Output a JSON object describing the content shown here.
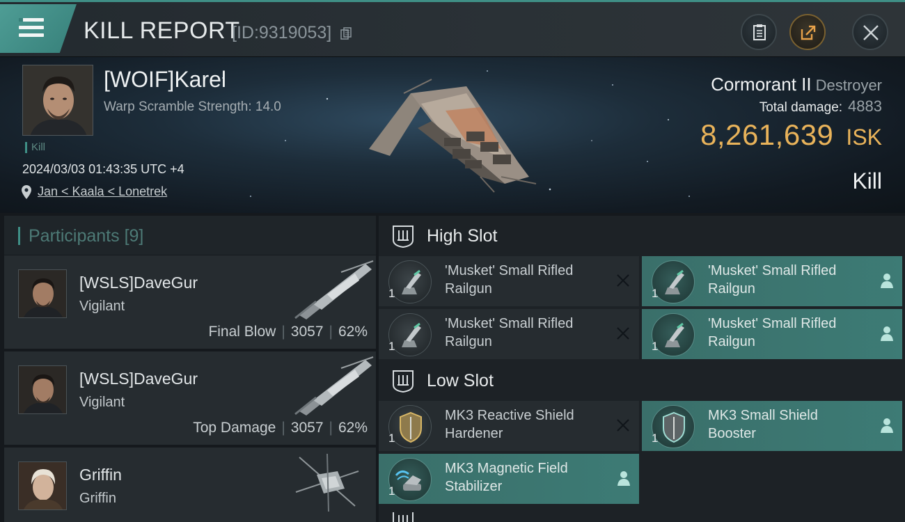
{
  "header": {
    "title": "KILL REPORT",
    "report_id": "[ID:9319053]"
  },
  "victim": {
    "name": "[WOIF]Karel",
    "warp_scramble": "Warp Scramble Strength: 14.0",
    "tag": "Kill",
    "datetime": "2024/03/03 01:43:35 UTC +4",
    "location": "Jan < Kaala < Lonetrek",
    "ship_name": "Cormorant II",
    "ship_class": "Destroyer",
    "total_damage_label": "Total damage:",
    "total_damage": "4883",
    "isk_value": "8,261,639",
    "isk_unit": "ISK",
    "result": "Kill"
  },
  "participants": {
    "label": "Participants",
    "count": "[9]",
    "items": [
      {
        "name": "[WSLS]DaveGur",
        "ship": "Vigilant",
        "role": "Final Blow",
        "damage": "3057",
        "percent": "62%"
      },
      {
        "name": "[WSLS]DaveGur",
        "ship": "Vigilant",
        "role": "Top Damage",
        "damage": "3057",
        "percent": "62%"
      },
      {
        "name": "Griffin",
        "ship": "Griffin"
      }
    ]
  },
  "fitting": {
    "high_slot": {
      "label": "High Slot",
      "modules": [
        {
          "name": "'Musket' Small Rifled Railgun",
          "qty": "1",
          "state": "destroyed",
          "icon": "railgun-icon"
        },
        {
          "name": "'Musket' Small Rifled Railgun",
          "qty": "1",
          "state": "dropped",
          "icon": "railgun-icon"
        },
        {
          "name": "'Musket' Small Rifled Railgun",
          "qty": "1",
          "state": "destroyed",
          "icon": "railgun-icon"
        },
        {
          "name": "'Musket' Small Rifled Railgun",
          "qty": "1",
          "state": "dropped",
          "icon": "railgun-icon"
        }
      ]
    },
    "low_slot": {
      "label": "Low Slot",
      "modules": [
        {
          "name": "MK3 Reactive Shield Hardener",
          "qty": "1",
          "state": "destroyed",
          "icon": "shield-hardener-icon"
        },
        {
          "name": "MK3 Small Shield Booster",
          "qty": "1",
          "state": "dropped",
          "icon": "shield-booster-icon"
        },
        {
          "name": "MK3 Magnetic Field Stabilizer",
          "qty": "1",
          "state": "dropped",
          "icon": "magnetic-stabilizer-icon"
        }
      ]
    }
  },
  "colors": {
    "accent": "#3f8f86",
    "isk": "#e9b35a",
    "dropped_bg": "#3d7b75",
    "destroyed_bg": "#262c30"
  }
}
